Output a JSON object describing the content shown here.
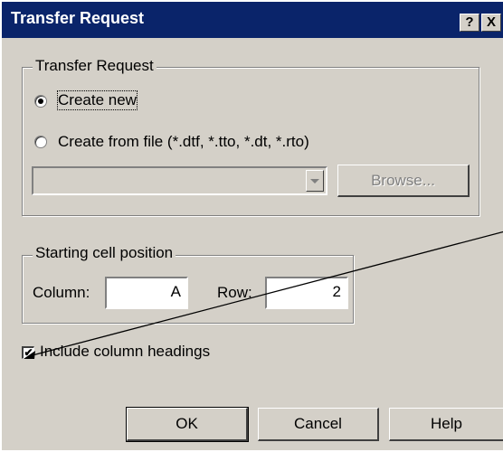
{
  "window": {
    "title": "Transfer Request",
    "help_button": "?",
    "close_button": "X"
  },
  "transfer_group": {
    "legend": "Transfer Request",
    "radio_create_new": {
      "label": "Create new",
      "selected": true
    },
    "radio_from_file": {
      "label": "Create from file (*.dtf, *.tto, *.dt, *.rto)",
      "selected": false
    },
    "file_combo_value": "",
    "browse_label": "Browse..."
  },
  "start_group": {
    "legend": "Starting cell position",
    "column_label": "Column:",
    "column_value": "A",
    "row_label": "Row:",
    "row_value": "2"
  },
  "include_headings": {
    "label": "Include column headings",
    "checked": true
  },
  "buttons": {
    "ok": "OK",
    "cancel": "Cancel",
    "help": "Help"
  }
}
